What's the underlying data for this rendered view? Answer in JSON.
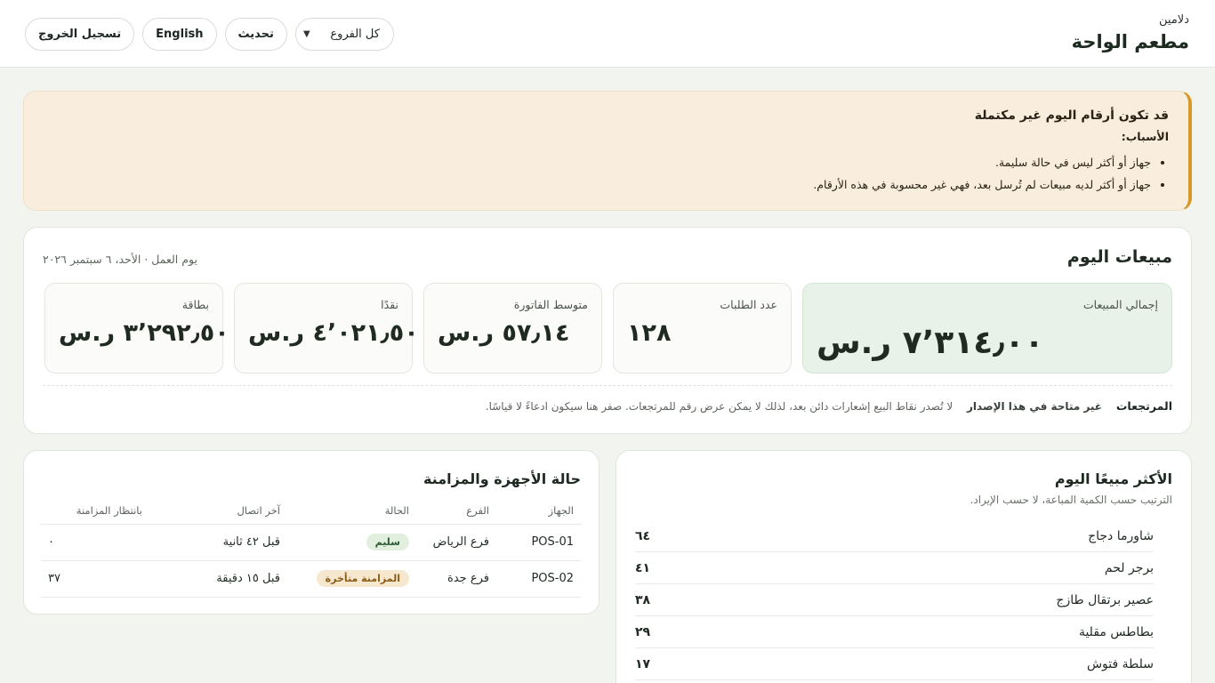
{
  "header": {
    "brand_sub": "دلامين",
    "brand_title": "مطعم الواحة",
    "branch_select": "كل الفروع",
    "refresh": "تحديث",
    "language": "English",
    "logout": "تسجيل الخروج"
  },
  "warning": {
    "title": "قد تكون أرقام اليوم غير مكتملة",
    "reasons_label": "الأسباب:",
    "reasons": [
      "جهاز أو أكثر ليس في حالة سليمة.",
      "جهاز أو أكثر لديه مبيعات لم تُرسل بعد، فهي غير محسوبة في هذه الأرقام."
    ]
  },
  "sales": {
    "title": "مبيعات اليوم",
    "business_day": "يوم العمل · الأحد، ٦ سبتمبر ٢٠٢٦",
    "kpis": [
      {
        "label": "إجمالي المبيعات",
        "value": "٧٬٣١٤٫٠٠ ر.س"
      },
      {
        "label": "عدد الطلبات",
        "value": "١٢٨"
      },
      {
        "label": "متوسط الفاتورة",
        "value": "٥٧٫١٤ ر.س"
      },
      {
        "label": "نقدًا",
        "value": "٤٬٠٢١٫٥٠ ر.س"
      },
      {
        "label": "بطاقة",
        "value": "٣٬٢٩٢٫٥٠ ر.س"
      }
    ],
    "returns_label": "المرتجعات",
    "returns_status": "غير متاحة في هذا الإصدار",
    "returns_note": "لا تُصدر نقاط البيع إشعارات دائن بعد، لذلك لا يمكن عرض رقم للمرتجعات. صفر هنا سيكون ادعاءً لا قياسًا."
  },
  "top_sellers": {
    "title": "الأكثر مبيعًا اليوم",
    "hint": "الترتيب حسب الكمية المباعة، لا حسب الإيراد.",
    "items": [
      {
        "name": "شاورما دجاج",
        "count": "٦٤"
      },
      {
        "name": "برجر لحم",
        "count": "٤١"
      },
      {
        "name": "عصير برتقال طازج",
        "count": "٣٨"
      },
      {
        "name": "بطاطس مقلية",
        "count": "٢٩"
      },
      {
        "name": "سلطة فتوش",
        "count": "١٧"
      }
    ]
  },
  "devices": {
    "title": "حالة الأجهزة والمزامنة",
    "columns": [
      "الجهاز",
      "الفرع",
      "الحالة",
      "آخر اتصال",
      "بانتظار المزامنة"
    ],
    "rows": [
      {
        "device": "POS-01",
        "branch": "فرع الرياض",
        "status": "سليم",
        "last_seen": "قبل ٤٢ ثانية",
        "pending": "٠"
      },
      {
        "device": "POS-02",
        "branch": "فرع جدة",
        "status": "المزامنة متأخرة",
        "last_seen": "قبل ١٥ دقيقة",
        "pending": "٣٧"
      }
    ]
  }
}
